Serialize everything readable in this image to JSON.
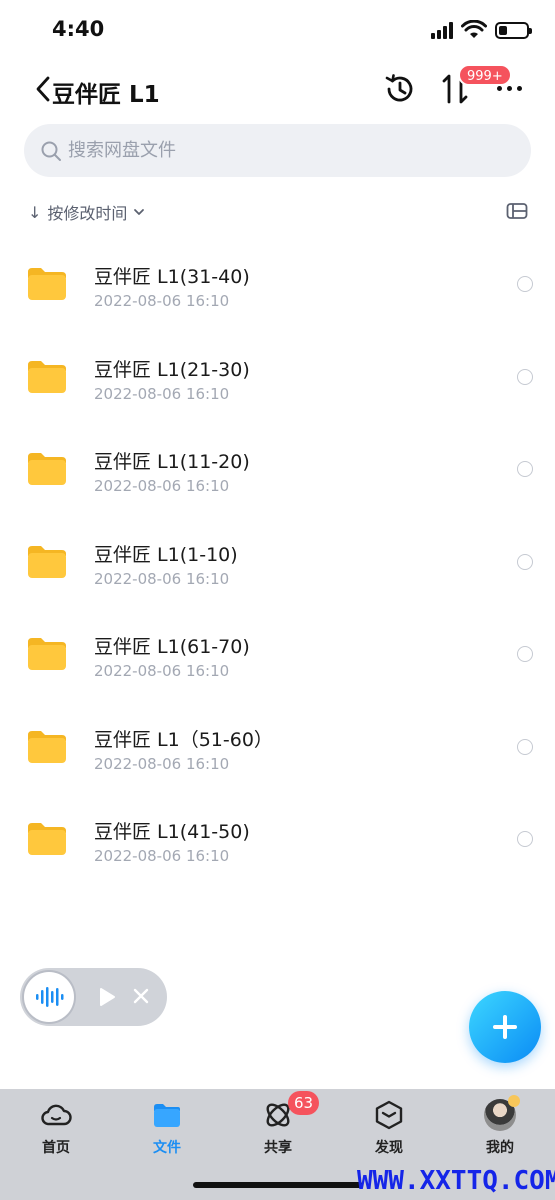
{
  "status_bar": {
    "time": "4:40"
  },
  "header": {
    "title": "豆伴匠 L1",
    "transfer_badge": "999+"
  },
  "search": {
    "placeholder": "搜索网盘文件"
  },
  "sort": {
    "arrow": "↓",
    "label": "按修改时间"
  },
  "files": [
    {
      "name": "豆伴匠 L1(31-40)",
      "time": "2022-08-06 16:10"
    },
    {
      "name": "豆伴匠 L1(21-30)",
      "time": "2022-08-06 16:10"
    },
    {
      "name": "豆伴匠 L1(11-20)",
      "time": "2022-08-06 16:10"
    },
    {
      "name": "豆伴匠 L1(1-10)",
      "time": "2022-08-06 16:10"
    },
    {
      "name": "豆伴匠 L1(61-70)",
      "time": "2022-08-06 16:10"
    },
    {
      "name": "豆伴匠 L1（51-60）",
      "time": "2022-08-06 16:10"
    },
    {
      "name": "豆伴匠 L1(41-50)",
      "time": "2022-08-06 16:10"
    }
  ],
  "tabs": [
    {
      "label": "首页",
      "icon": "cloud-icon"
    },
    {
      "label": "文件",
      "icon": "folder-icon",
      "active": true
    },
    {
      "label": "共享",
      "icon": "orbit-icon",
      "badge": "63"
    },
    {
      "label": "发现",
      "icon": "cube-icon"
    },
    {
      "label": "我的",
      "icon": "avatar"
    }
  ],
  "watermark": "WWW.XXTTQ.COM",
  "colors": {
    "accent": "#1b8ef3",
    "badge": "#f5535d",
    "folder": "#ffc83d"
  }
}
